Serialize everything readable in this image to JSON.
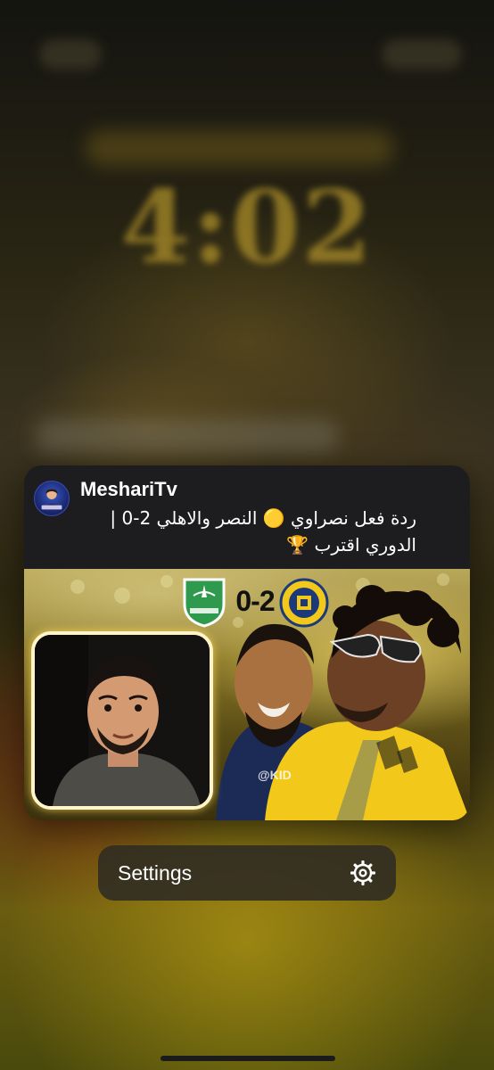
{
  "lock_screen": {
    "time": "4:02"
  },
  "notification": {
    "app_name": "MeshariTv",
    "avatar_icon": "channel-avatar-icon",
    "body_line_1": "ردة فعل نصراوي 🟡 النصر والاهلي 2-0 |",
    "body_line_2": "الدوري اقترب 🏆",
    "thumbnail": {
      "score": "0-2",
      "watermark": "@KID"
    }
  },
  "menu": {
    "settings_label": "Settings",
    "settings_icon": "gear-icon"
  },
  "colors": {
    "card_bg": "#1d1d1f",
    "settings_bg": "#322e22",
    "accent_yellow": "#f2c81b"
  }
}
